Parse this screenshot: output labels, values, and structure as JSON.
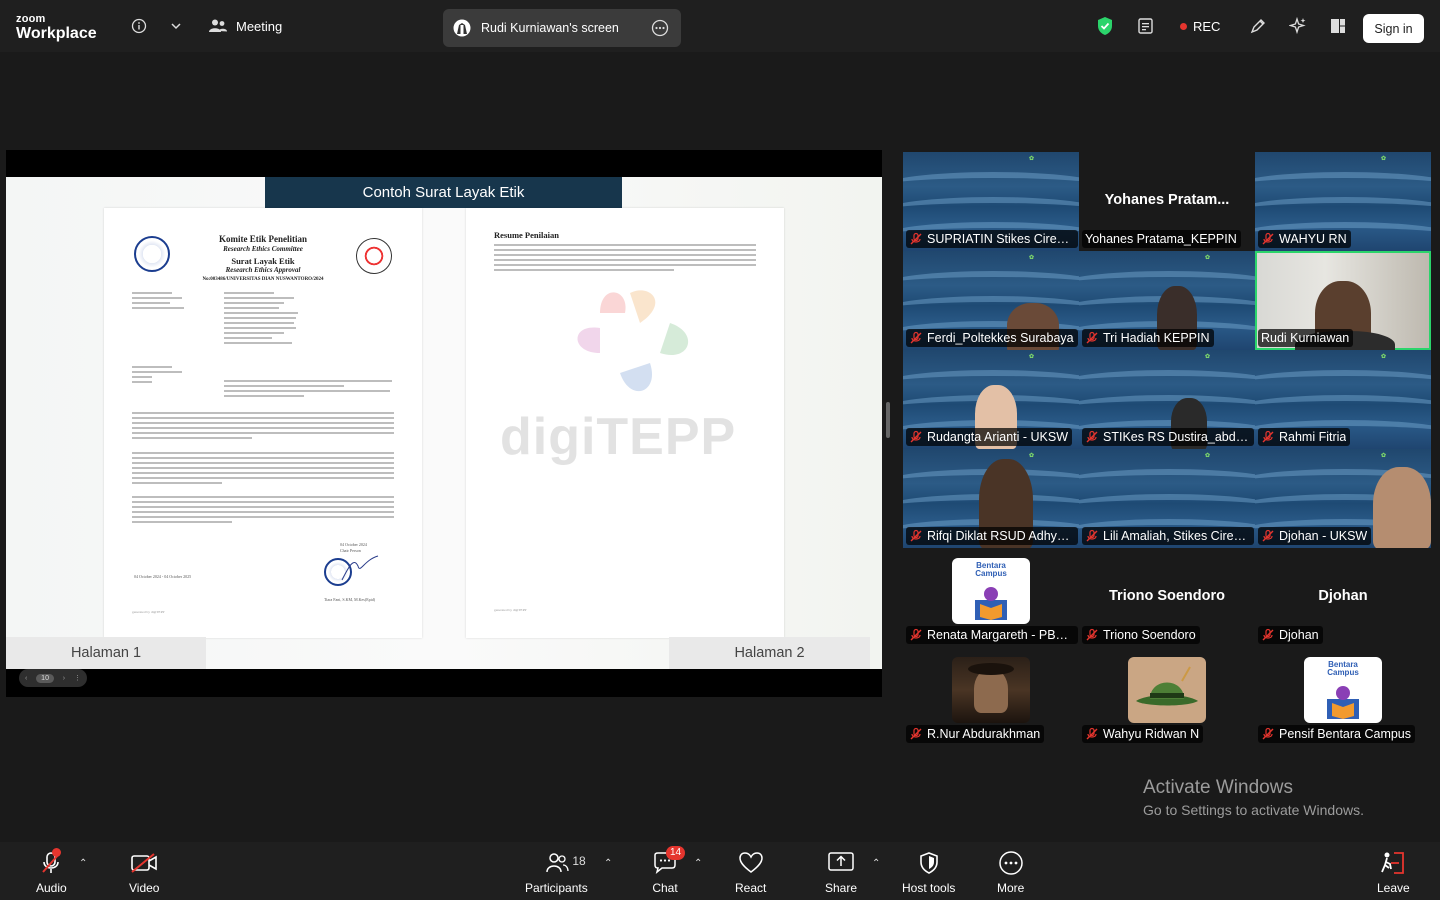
{
  "brand": {
    "line1": "zoom",
    "line2": "Workplace"
  },
  "topbar": {
    "meeting_label": "Meeting",
    "screen_share_label": "Rudi Kurniawan's screen",
    "rec_label": "REC",
    "signin_label": "Sign in"
  },
  "shared_screen": {
    "slide_title": "Contoh Surat Layak Etik",
    "page1": {
      "header1": "Komite Etik Penelitian",
      "header2": "Research Ethics Committee",
      "header3": "Surat Layak Etik",
      "header4": "Research Ethics Approval",
      "number": "No:003486/UNIVERSITAS DIAN NUSWANTORO/2024",
      "date": "04 October 2024",
      "chair": "Chair Person",
      "signer": "Tiara Fani, S.KM, M.Kes(Epid)",
      "validity": "04 October 2024 - 04 October 2025"
    },
    "page2": {
      "title": "Resume Penilaian"
    },
    "watermark": "digiTEPP",
    "page_label_1": "Halaman 1",
    "page_label_2": "Halaman 2",
    "pager_current": "10"
  },
  "gallery": [
    {
      "name": "SUPRIATIN Stikes Cirebon",
      "muted": true
    },
    {
      "name": "Yohanes Pratama_KEPPIN",
      "big_name": "Yohanes  Pratam...",
      "muted": false
    },
    {
      "name": "WAHYU RN",
      "muted": true
    },
    {
      "name": "Ferdi_Poltekkes Surabaya",
      "muted": true
    },
    {
      "name": "Tri Hadiah KEPPIN",
      "muted": true
    },
    {
      "name": "Rudi Kurniawan",
      "muted": false,
      "active": true
    },
    {
      "name": "Rudangta Arianti - UKSW",
      "muted": true
    },
    {
      "name": "STIKes RS Dustira_abdul...",
      "muted": true
    },
    {
      "name": "Rahmi Fitria",
      "muted": true
    },
    {
      "name": "Rifqi Diklat RSUD Adhya...",
      "muted": true
    },
    {
      "name": "Lili Amaliah, Stikes Cireb...",
      "muted": true
    },
    {
      "name": "Djohan - UKSW",
      "muted": true
    },
    {
      "name": "Renata Margareth - PBC...",
      "muted": true
    },
    {
      "name": "Triono Soendoro",
      "big_name": "Triono Soendoro",
      "muted": true
    },
    {
      "name": "Djohan",
      "big_name": "Djohan",
      "muted": true
    },
    {
      "name": "R.Nur Abdurakhman",
      "muted": true
    },
    {
      "name": "Wahyu Ridwan N",
      "muted": true
    },
    {
      "name": "Pensif Bentara Campus",
      "muted": true
    }
  ],
  "bentara": {
    "line1": "Bentara",
    "line2": "Campus"
  },
  "activate": {
    "line1": "Activate Windows",
    "line2": "Go to Settings to activate Windows."
  },
  "toolbar": {
    "audio": "Audio",
    "video": "Video",
    "participants": "Participants",
    "participants_count": "18",
    "chat": "Chat",
    "chat_badge": "14",
    "react": "React",
    "share": "Share",
    "host_tools": "Host tools",
    "more": "More",
    "leave": "Leave"
  },
  "colors": {
    "accent_green": "#2bd46b",
    "rec_red": "#e5352e",
    "slide_title_bg": "#17364c"
  }
}
